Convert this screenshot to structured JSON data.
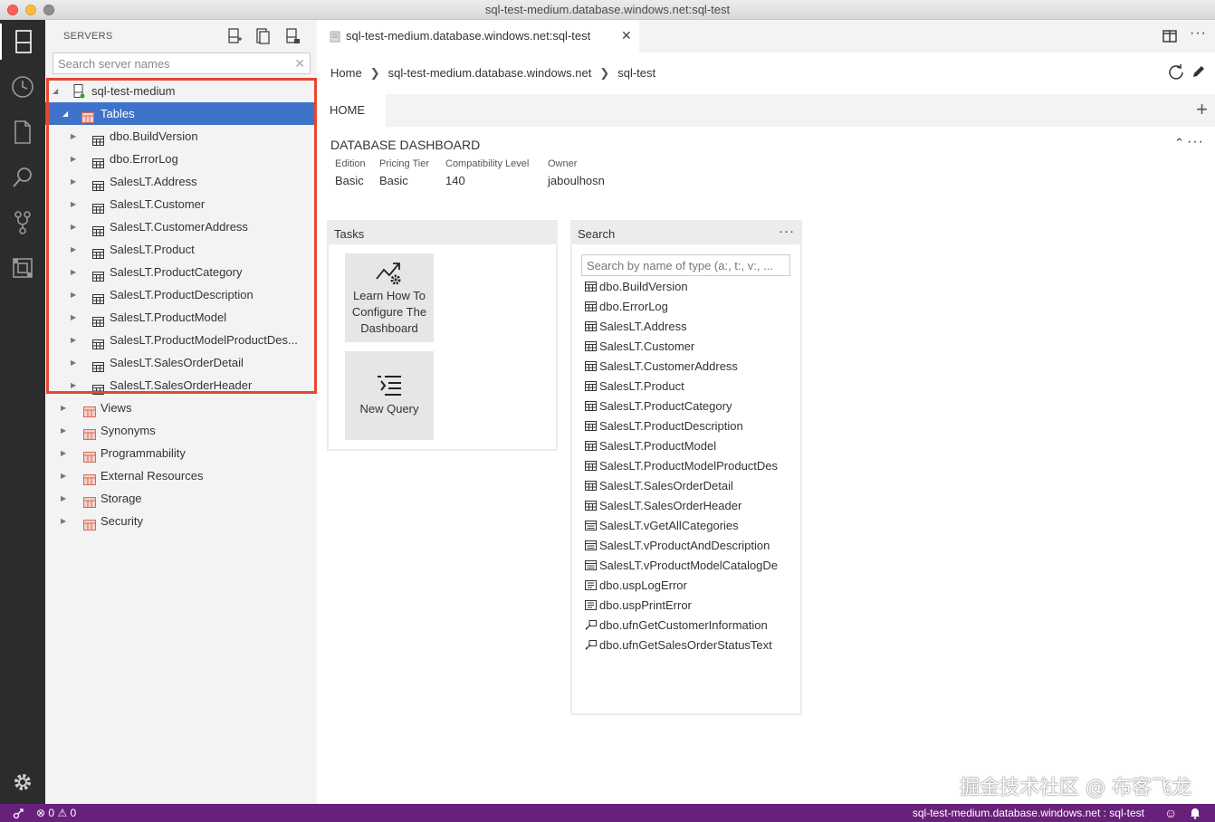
{
  "window": {
    "title": "sql-test-medium.database.windows.net:sql-test"
  },
  "sidebar": {
    "title": "SERVERS",
    "search_placeholder": "Search server names",
    "tree": [
      {
        "label": "sql-test-medium",
        "level": 0,
        "expanded": true,
        "icon": "server-icon"
      },
      {
        "label": "Tables",
        "level": 1,
        "expanded": true,
        "selected": true,
        "icon": "folder-icon"
      },
      {
        "label": "dbo.BuildVersion",
        "level": 2,
        "icon": "table-icon"
      },
      {
        "label": "dbo.ErrorLog",
        "level": 2,
        "icon": "table-icon"
      },
      {
        "label": "SalesLT.Address",
        "level": 2,
        "icon": "table-icon"
      },
      {
        "label": "SalesLT.Customer",
        "level": 2,
        "icon": "table-icon"
      },
      {
        "label": "SalesLT.CustomerAddress",
        "level": 2,
        "icon": "table-icon"
      },
      {
        "label": "SalesLT.Product",
        "level": 2,
        "icon": "table-icon"
      },
      {
        "label": "SalesLT.ProductCategory",
        "level": 2,
        "icon": "table-icon"
      },
      {
        "label": "SalesLT.ProductDescription",
        "level": 2,
        "icon": "table-icon"
      },
      {
        "label": "SalesLT.ProductModel",
        "level": 2,
        "icon": "table-icon"
      },
      {
        "label": "SalesLT.ProductModelProductDes...",
        "level": 2,
        "icon": "table-icon"
      },
      {
        "label": "SalesLT.SalesOrderDetail",
        "level": 2,
        "icon": "table-icon"
      },
      {
        "label": "SalesLT.SalesOrderHeader",
        "level": 2,
        "icon": "table-icon"
      },
      {
        "label": "Views",
        "level": 1,
        "icon": "folder-icon"
      },
      {
        "label": "Synonyms",
        "level": 1,
        "icon": "folder-icon"
      },
      {
        "label": "Programmability",
        "level": 1,
        "icon": "folder-icon"
      },
      {
        "label": "External Resources",
        "level": 1,
        "icon": "folder-icon"
      },
      {
        "label": "Storage",
        "level": 1,
        "icon": "folder-icon"
      },
      {
        "label": "Security",
        "level": 1,
        "icon": "folder-icon"
      }
    ]
  },
  "editor": {
    "tab_label": "sql-test-medium.database.windows.net:sql-test",
    "breadcrumb": [
      "Home",
      "sql-test-medium.database.windows.net",
      "sql-test"
    ],
    "home_tab": "HOME",
    "dashboard": {
      "title": "DATABASE DASHBOARD",
      "props": [
        {
          "label": "Edition",
          "value": "Basic"
        },
        {
          "label": "Pricing Tier",
          "value": "Basic"
        },
        {
          "label": "Compatibility Level",
          "value": "140"
        },
        {
          "label": "Owner",
          "value": "jaboulhosn"
        }
      ]
    },
    "tasks": {
      "title": "Tasks",
      "items": [
        {
          "label": "Learn How To Configure The Dashboard",
          "icon": "chart-gear-icon"
        },
        {
          "label": "New Query",
          "icon": "new-query-icon"
        }
      ]
    },
    "search": {
      "title": "Search",
      "placeholder": "Search by name of type (a:, t:, v:, ...",
      "items": [
        {
          "label": "dbo.BuildVersion",
          "icon": "table-icon"
        },
        {
          "label": "dbo.ErrorLog",
          "icon": "table-icon"
        },
        {
          "label": "SalesLT.Address",
          "icon": "table-icon"
        },
        {
          "label": "SalesLT.Customer",
          "icon": "table-icon"
        },
        {
          "label": "SalesLT.CustomerAddress",
          "icon": "table-icon"
        },
        {
          "label": "SalesLT.Product",
          "icon": "table-icon"
        },
        {
          "label": "SalesLT.ProductCategory",
          "icon": "table-icon"
        },
        {
          "label": "SalesLT.ProductDescription",
          "icon": "table-icon"
        },
        {
          "label": "SalesLT.ProductModel",
          "icon": "table-icon"
        },
        {
          "label": "SalesLT.ProductModelProductDes",
          "icon": "table-icon"
        },
        {
          "label": "SalesLT.SalesOrderDetail",
          "icon": "table-icon"
        },
        {
          "label": "SalesLT.SalesOrderHeader",
          "icon": "table-icon"
        },
        {
          "label": "SalesLT.vGetAllCategories",
          "icon": "view-icon"
        },
        {
          "label": "SalesLT.vProductAndDescription",
          "icon": "view-icon"
        },
        {
          "label": "SalesLT.vProductModelCatalogDe",
          "icon": "view-icon"
        },
        {
          "label": "dbo.uspLogError",
          "icon": "procedure-icon"
        },
        {
          "label": "dbo.uspPrintError",
          "icon": "procedure-icon"
        },
        {
          "label": "dbo.ufnGetCustomerInformation",
          "icon": "function-icon"
        },
        {
          "label": "dbo.ufnGetSalesOrderStatusText",
          "icon": "function-icon"
        }
      ]
    }
  },
  "statusbar": {
    "errors": "0",
    "warnings": "0",
    "connection": "sql-test-medium.database.windows.net : sql-test"
  },
  "watermark": "掘金技术社区 @ 布客飞龙",
  "colors": {
    "selection": "#3f73c9",
    "statusbar": "#68217a",
    "highlight_border": "#e8462e",
    "activitybar": "#2c2c2c"
  }
}
